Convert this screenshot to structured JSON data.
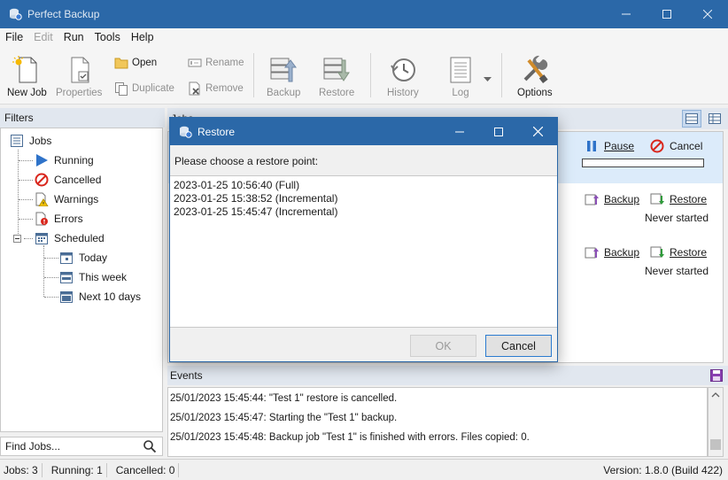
{
  "window": {
    "title": "Perfect Backup"
  },
  "menu": [
    "File",
    "Edit",
    "Run",
    "Tools",
    "Help"
  ],
  "toolbar": {
    "new_job": "New Job",
    "properties": "Properties",
    "open": "Open",
    "duplicate": "Duplicate",
    "rename": "Rename",
    "remove": "Remove",
    "backup": "Backup",
    "restore": "Restore",
    "history": "History",
    "log": "Log",
    "options": "Options"
  },
  "filters": {
    "header": "Filters",
    "jobs": "Jobs",
    "running": "Running",
    "cancelled": "Cancelled",
    "warnings": "Warnings",
    "errors": "Errors",
    "scheduled": "Scheduled",
    "today": "Today",
    "this_week": "This week",
    "next_10_days": "Next 10 days",
    "find_placeholder": "Find Jobs..."
  },
  "jobs": {
    "header": "Jobs",
    "row1": {
      "pause": "Pause",
      "cancel": "Cancel",
      "progress": 0
    },
    "row2": {
      "backup": "Backup",
      "restore": "Restore",
      "status": "Never started"
    },
    "row3": {
      "backup": "Backup",
      "restore": "Restore",
      "status": "Never started"
    }
  },
  "events": {
    "header": "Events",
    "lines": [
      "25/01/2023 15:45:44: \"Test 1\" restore is cancelled.",
      "25/01/2023 15:45:47: Starting the \"Test 1\" backup.",
      "25/01/2023 15:45:48: Backup job \"Test 1\" is finished with errors. Files copied: 0."
    ]
  },
  "status": {
    "jobs": "Jobs: 3",
    "running": "Running: 1",
    "cancelled": "Cancelled: 0",
    "version": "Version: 1.8.0 (Build 422)"
  },
  "dialog": {
    "title": "Restore",
    "prompt": "Please choose a restore point:",
    "points": [
      "2023-01-25 10:56:40 (Full)",
      "2023-01-25 15:38:52 (Incremental)",
      "2023-01-25 15:45:47 (Incremental)"
    ],
    "ok": "OK",
    "cancel": "Cancel"
  },
  "colors": {
    "accent": "#2b68a8",
    "panel_header": "#e1e7ef",
    "selection": "#dcebfa",
    "progress": "#2ea02e"
  }
}
